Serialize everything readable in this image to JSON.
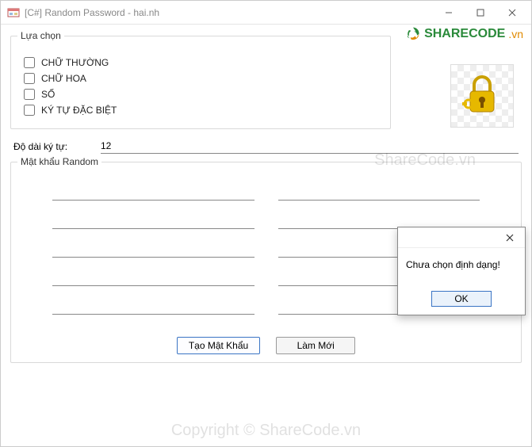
{
  "window": {
    "title": "[C#] Random Password - hai.nh"
  },
  "brand": {
    "name": "SHARECODE",
    "tld": ".vn"
  },
  "options": {
    "legend": "Lựa chọn",
    "items": [
      {
        "label": "CHỮ THƯỜNG",
        "checked": false
      },
      {
        "label": "CHỮ HOA",
        "checked": false
      },
      {
        "label": "SỐ",
        "checked": false
      },
      {
        "label": "KÝ TỰ ĐẶC BIỆT",
        "checked": false
      }
    ]
  },
  "length": {
    "label": "Độ dài ký tự:",
    "value": "12"
  },
  "random": {
    "legend": "Mật khẩu Random",
    "outputs_left": [
      "",
      "",
      "",
      "",
      ""
    ],
    "outputs_right": [
      "",
      "",
      "",
      "",
      ""
    ]
  },
  "buttons": {
    "generate": "Tạo Mật Khẩu",
    "refresh": "Làm Mới"
  },
  "dialog": {
    "message": "Chưa chọn định dạng!",
    "ok": "OK"
  },
  "watermark": {
    "mid": "ShareCode.vn",
    "bottom": "Copyright © ShareCode.vn"
  }
}
